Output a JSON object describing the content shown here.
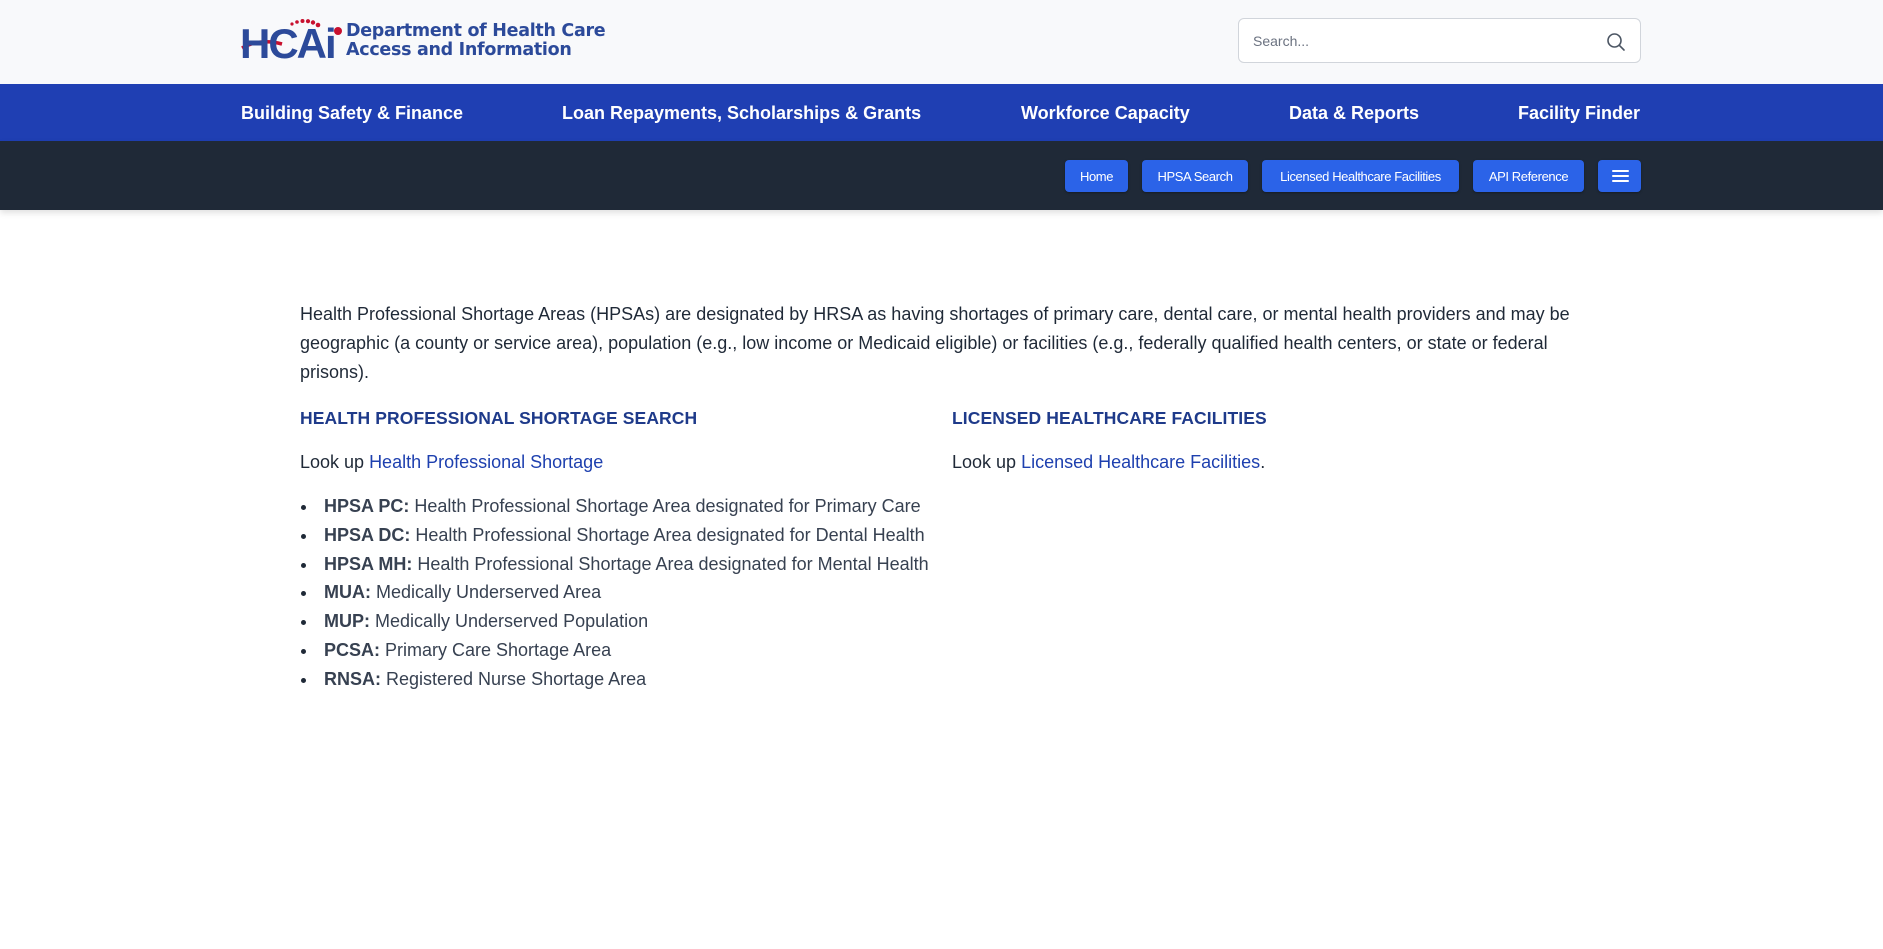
{
  "header": {
    "logo_letters": "HCAi",
    "logo_line1": "Department of Health Care",
    "logo_line2": "Access and Information",
    "search_placeholder": "Search...",
    "search_icon": "search-icon"
  },
  "primary_nav": [
    {
      "label": "Building Safety & Finance"
    },
    {
      "label": "Loan Repayments, Scholarships & Grants"
    },
    {
      "label": "Workforce Capacity"
    },
    {
      "label": "Data & Reports"
    },
    {
      "label": "Facility Finder"
    }
  ],
  "secondary_nav": {
    "buttons": [
      {
        "label": "Home"
      },
      {
        "label": "HPSA Search"
      },
      {
        "label": "Licensed Healthcare Facilities"
      },
      {
        "label": "API Reference"
      }
    ],
    "menu_icon": "hamburger-menu-icon"
  },
  "main": {
    "intro": "Health Professional Shortage Areas (HPSAs) are designated by HRSA as having shortages of primary care, dental care, or mental health providers and may be geographic (a county or service area), population (e.g., low income or Medicaid eligible) or facilities (e.g., federally qualified health centers, or state or federal prisons).",
    "left": {
      "title": "HEALTH PROFESSIONAL SHORTAGE SEARCH",
      "lookup_prefix": "Look up ",
      "lookup_link": "Health Professional Shortage",
      "definitions": [
        {
          "term": "HPSA PC:",
          "desc": " Health Professional Shortage Area designated for Primary Care"
        },
        {
          "term": "HPSA DC:",
          "desc": " Health Professional Shortage Area designated for Dental Health"
        },
        {
          "term": "HPSA MH:",
          "desc": " Health Professional Shortage Area designated for Mental Health"
        },
        {
          "term": "MUA:",
          "desc": " Medically Underserved Area"
        },
        {
          "term": "MUP:",
          "desc": " Medically Underserved Population"
        },
        {
          "term": "PCSA:",
          "desc": " Primary Care Shortage Area"
        },
        {
          "term": "RNSA:",
          "desc": " Registered Nurse Shortage Area"
        }
      ]
    },
    "right": {
      "title": "LICENSED HEALTHCARE FACILITIES",
      "lookup_prefix": "Look up ",
      "lookup_link": "Licensed Healthcare Facilities",
      "lookup_suffix": "."
    }
  },
  "colors": {
    "primary_nav_bg": "#1f3fb3",
    "secondary_nav_bg": "#1f2937",
    "pill_bg": "#2b63e8",
    "heading": "#1e3a8a",
    "link": "#1e40af",
    "logo_red": "#c8102e"
  }
}
